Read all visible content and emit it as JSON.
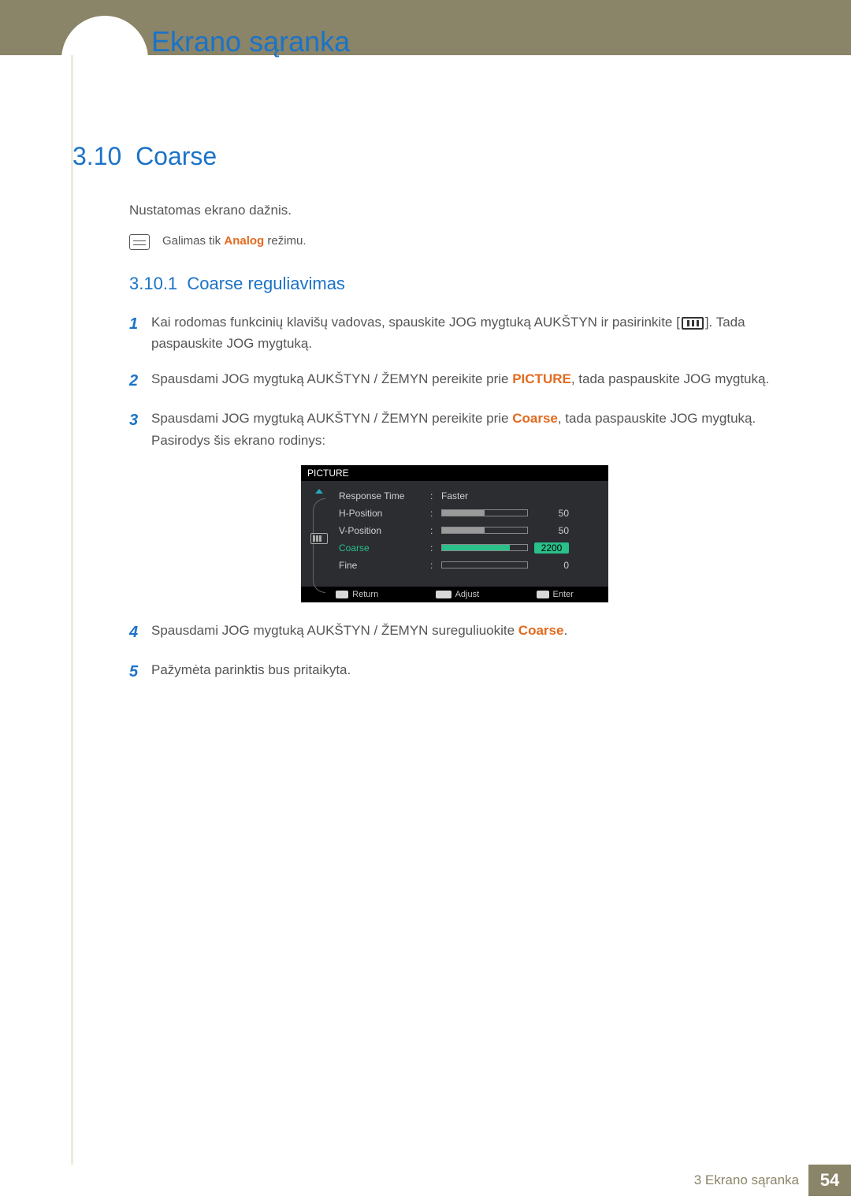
{
  "chapter": {
    "number": "3",
    "title": "Ekrano sąranka"
  },
  "section": {
    "number": "3.10",
    "title": "Coarse"
  },
  "intro": "Nustatomas ekrano dažnis.",
  "note": {
    "prefix": "Galimas tik ",
    "hl": "Analog",
    "suffix": " režimu."
  },
  "subsection": {
    "number": "3.10.1",
    "title": "Coarse reguliavimas"
  },
  "steps": [
    {
      "n": "1",
      "pre": "Kai rodomas funkcinių klavišų vadovas, spauskite JOG mygtuką AUKŠTYN ir pasirinkite [",
      "icon": true,
      "post": "]. Tada paspauskite JOG mygtuką."
    },
    {
      "n": "2",
      "pre": "Spausdami JOG mygtuką AUKŠTYN / ŽEMYN pereikite prie ",
      "hl": "PICTURE",
      "post": ", tada paspauskite JOG mygtuką."
    },
    {
      "n": "3",
      "pre": "Spausdami JOG mygtuką AUKŠTYN / ŽEMYN pereikite prie ",
      "hl": "Coarse",
      "post": ", tada paspauskite JOG mygtuką. Pasirodys šis ekrano rodinys:"
    },
    {
      "n": "4",
      "pre": "Spausdami JOG mygtuką AUKŠTYN / ŽEMYN sureguliuokite ",
      "hl": "Coarse",
      "post": "."
    },
    {
      "n": "5",
      "pre": "Pažymėta parinktis bus pritaikyta."
    }
  ],
  "osd": {
    "title": "PICTURE",
    "rows": [
      {
        "label": "Response Time",
        "value_text": "Faster"
      },
      {
        "label": "H-Position",
        "bar_pct": 50,
        "value": "50"
      },
      {
        "label": "V-Position",
        "bar_pct": 50,
        "value": "50"
      },
      {
        "label": "Coarse",
        "bar_pct": 80,
        "value": "2200",
        "selected": true
      },
      {
        "label": "Fine",
        "bar_pct": 0,
        "value": "0"
      }
    ],
    "footer": {
      "return": "Return",
      "adjust": "Adjust",
      "enter": "Enter"
    }
  },
  "footer": {
    "label": "3 Ekrano sąranka",
    "page": "54"
  }
}
